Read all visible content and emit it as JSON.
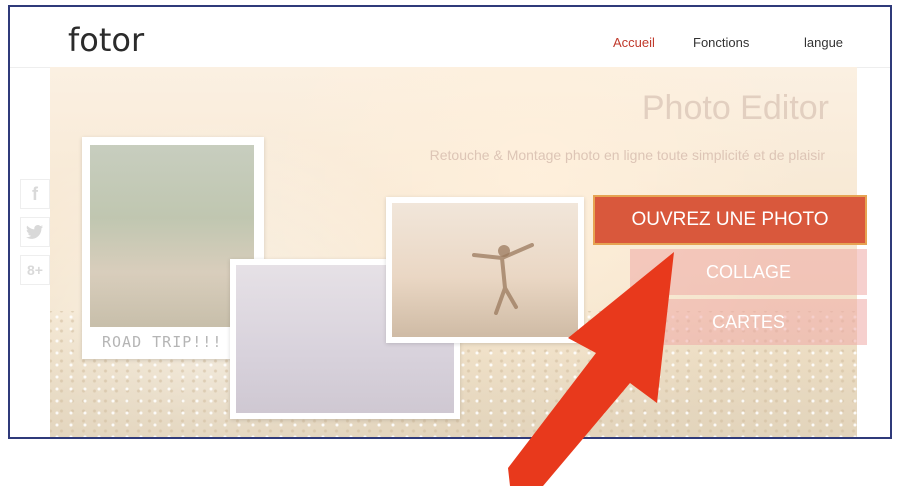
{
  "header": {
    "logo": "fotor",
    "nav": {
      "accueil": "Accueil",
      "fonctions": "Fonctions",
      "langue": "langue"
    }
  },
  "social": {
    "facebook": "f",
    "twitter": "t",
    "googleplus": "8+"
  },
  "hero": {
    "title": "Photo Editor",
    "subtitle": "Retouche & Montage photo en ligne toute simplicité et de plaisir",
    "primary_button": "OUVREZ UNE PHOTO",
    "collage_button": "COLLAGE",
    "cartes_button": "CARTES",
    "photo_caption": "ROAD TRIP!!!"
  },
  "colors": {
    "accent": "#d9583c",
    "arrow": "#e8391c",
    "frame_border": "#2f3a7a",
    "active_nav": "#c0392b"
  }
}
